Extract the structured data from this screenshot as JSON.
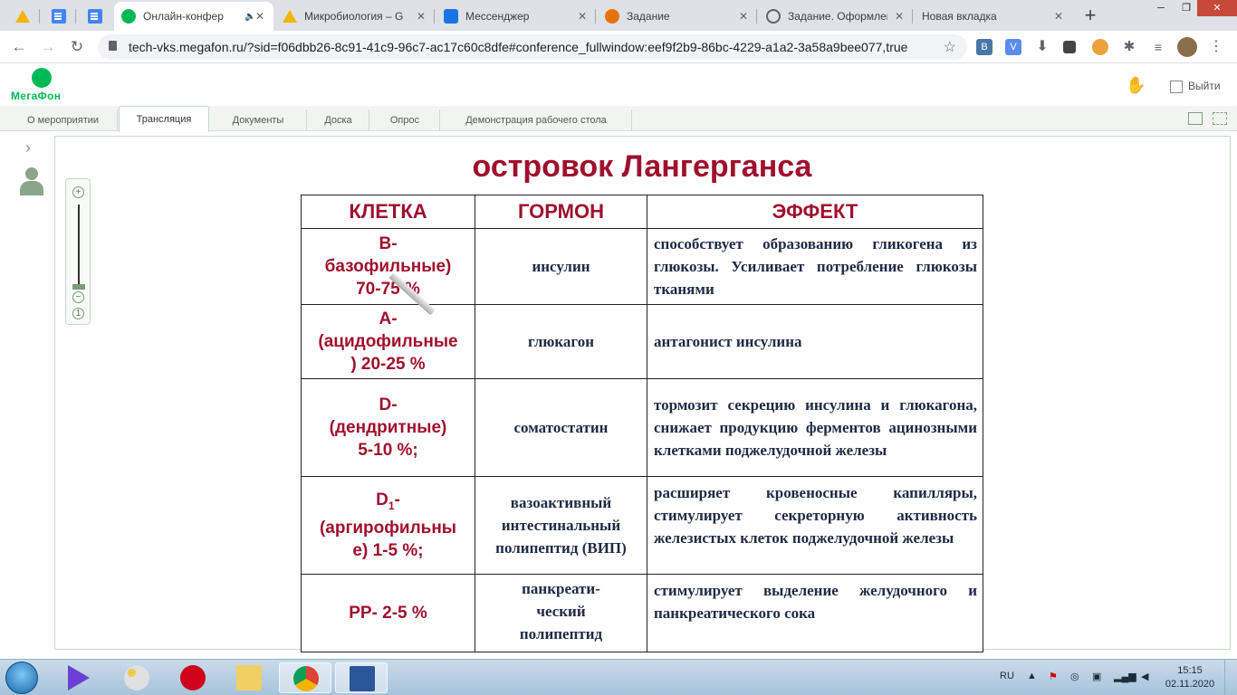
{
  "browser": {
    "tabs": [
      {
        "label": "",
        "icon": "google-drive-icon"
      },
      {
        "label": "",
        "icon": "google-docs-icon"
      },
      {
        "label": "",
        "icon": "google-docs-icon"
      },
      {
        "label": "Онлайн-конфер",
        "icon": "megafon-icon",
        "active": true
      },
      {
        "label": "Микробиология – G",
        "icon": "google-drive-icon"
      },
      {
        "label": "Мессенджер",
        "icon": "chat-icon"
      },
      {
        "label": "Задание",
        "icon": "graduation-icon"
      },
      {
        "label": "Задание. Оформлен",
        "icon": "globe-icon"
      },
      {
        "label": "Новая вкладка",
        "icon": ""
      }
    ],
    "url": "tech-vks.megafon.ru/?sid=f06dbb26-8c91-41c9-96c7-ac17c60c8dfe#conference_fullwindow:eef9f2b9-86bc-4229-a1a2-3a58a9bee077,true",
    "extensions": [
      "B",
      "V"
    ]
  },
  "app": {
    "logo_text": "МегаФон",
    "exit_label": "Выйти",
    "tabs": [
      "О мероприятии",
      "Трансляция",
      "Документы",
      "Доска",
      "Опрос",
      "Демонстрация рабочего стола"
    ],
    "active_tab": "Трансляция"
  },
  "zoom": {
    "plus": "+",
    "minus": "−",
    "reset": "1"
  },
  "slide": {
    "title": "островок Лангерганса",
    "headers": [
      "КЛЕТКА",
      "ГОРМОН",
      "ЭФФЕКТ"
    ],
    "rows": [
      {
        "cell": "B-\nбазофильные)\n70-75 %",
        "hormone": "инсулин",
        "effect": "способствует образованию гликогена из глюкозы. Усиливает потребление глюкозы тканями"
      },
      {
        "cell": "A-\n(ацидофильные\n) 20-25 %",
        "hormone": "глюкагон",
        "effect": "антагонист инсулина"
      },
      {
        "cell": "D-\n(дендритные)\n5-10 %;",
        "hormone": "соматостатин",
        "effect": "тормозит секрецию инсулина и глюкагона, снижает продукцию ферментов ацинозными клетками поджелудочной железы"
      },
      {
        "cell_main": "D",
        "cell_sub": "1",
        "cell_rest": "-\n(аргирофильны\nе) 1-5 %;",
        "hormone": "вазоактивный интестинальный полипептид (ВИП)",
        "effect": "расширяет кровеносные капилляры, стимулирует секреторную активность железистых клеток поджелудочной железы"
      },
      {
        "cell": "PP- 2-5 %",
        "hormone": "панкреати-\nческий\nполипептид",
        "effect": "стимулирует выделение желудочного и панкреатического сока"
      }
    ]
  },
  "taskbar": {
    "language": "RU",
    "time": "15:15",
    "date": "02.11.2020"
  }
}
